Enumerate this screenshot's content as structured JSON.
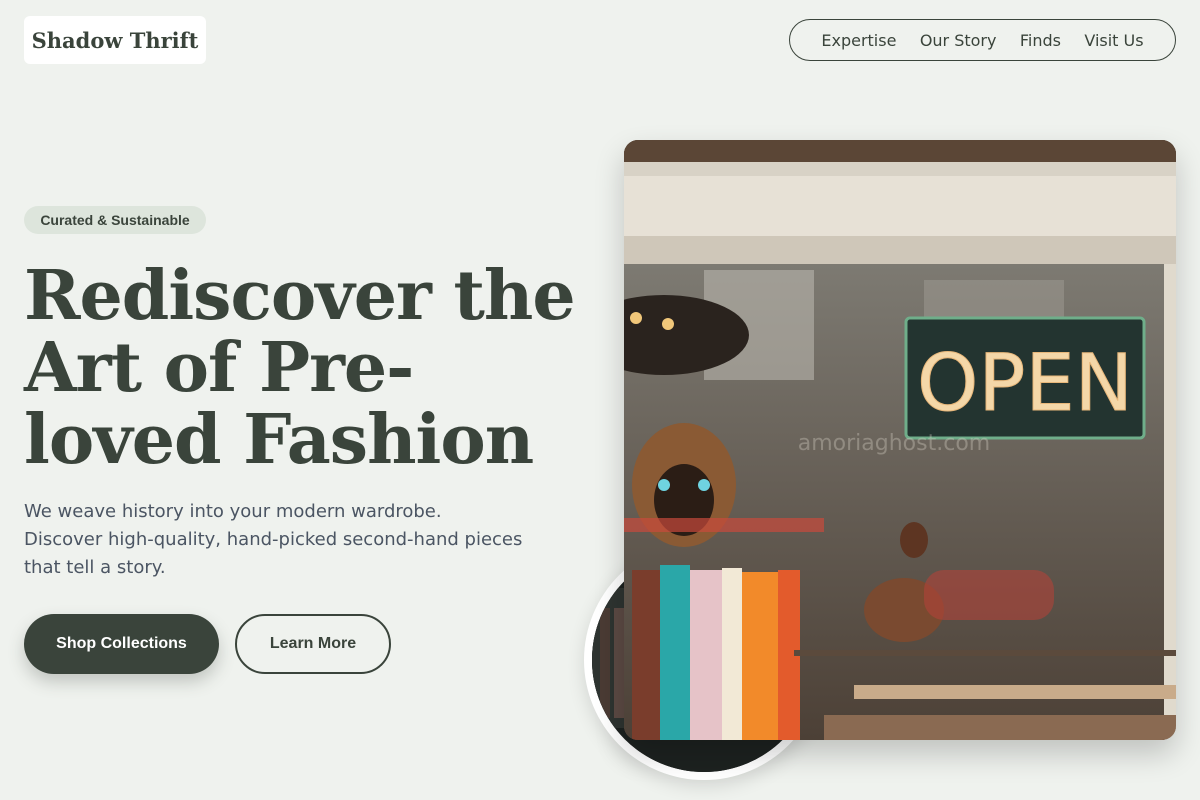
{
  "brand": {
    "name": "Shadow Thrift"
  },
  "nav": {
    "items": [
      {
        "label": "Expertise"
      },
      {
        "label": "Our Story"
      },
      {
        "label": "Finds"
      },
      {
        "label": "Visit Us"
      }
    ]
  },
  "hero": {
    "badge": "Curated & Sustainable",
    "title": "Rediscover the Art of Pre-loved Fashion",
    "subtitle": "We weave history into your modern wardrobe. Discover high-quality, hand-picked second-hand pieces that tell a story.",
    "primary_cta": "Shop Collections",
    "secondary_cta": "Learn More",
    "sign_text": "OPEN",
    "watermark": "amoriaghost.com"
  },
  "colors": {
    "background": "#eff2ee",
    "primary": "#3a443b",
    "badge_bg": "#dde5dc"
  },
  "icons": {
    "shop_photo": "thrift-shop-window-photo",
    "racks_photo": "clothing-racks-photo"
  }
}
